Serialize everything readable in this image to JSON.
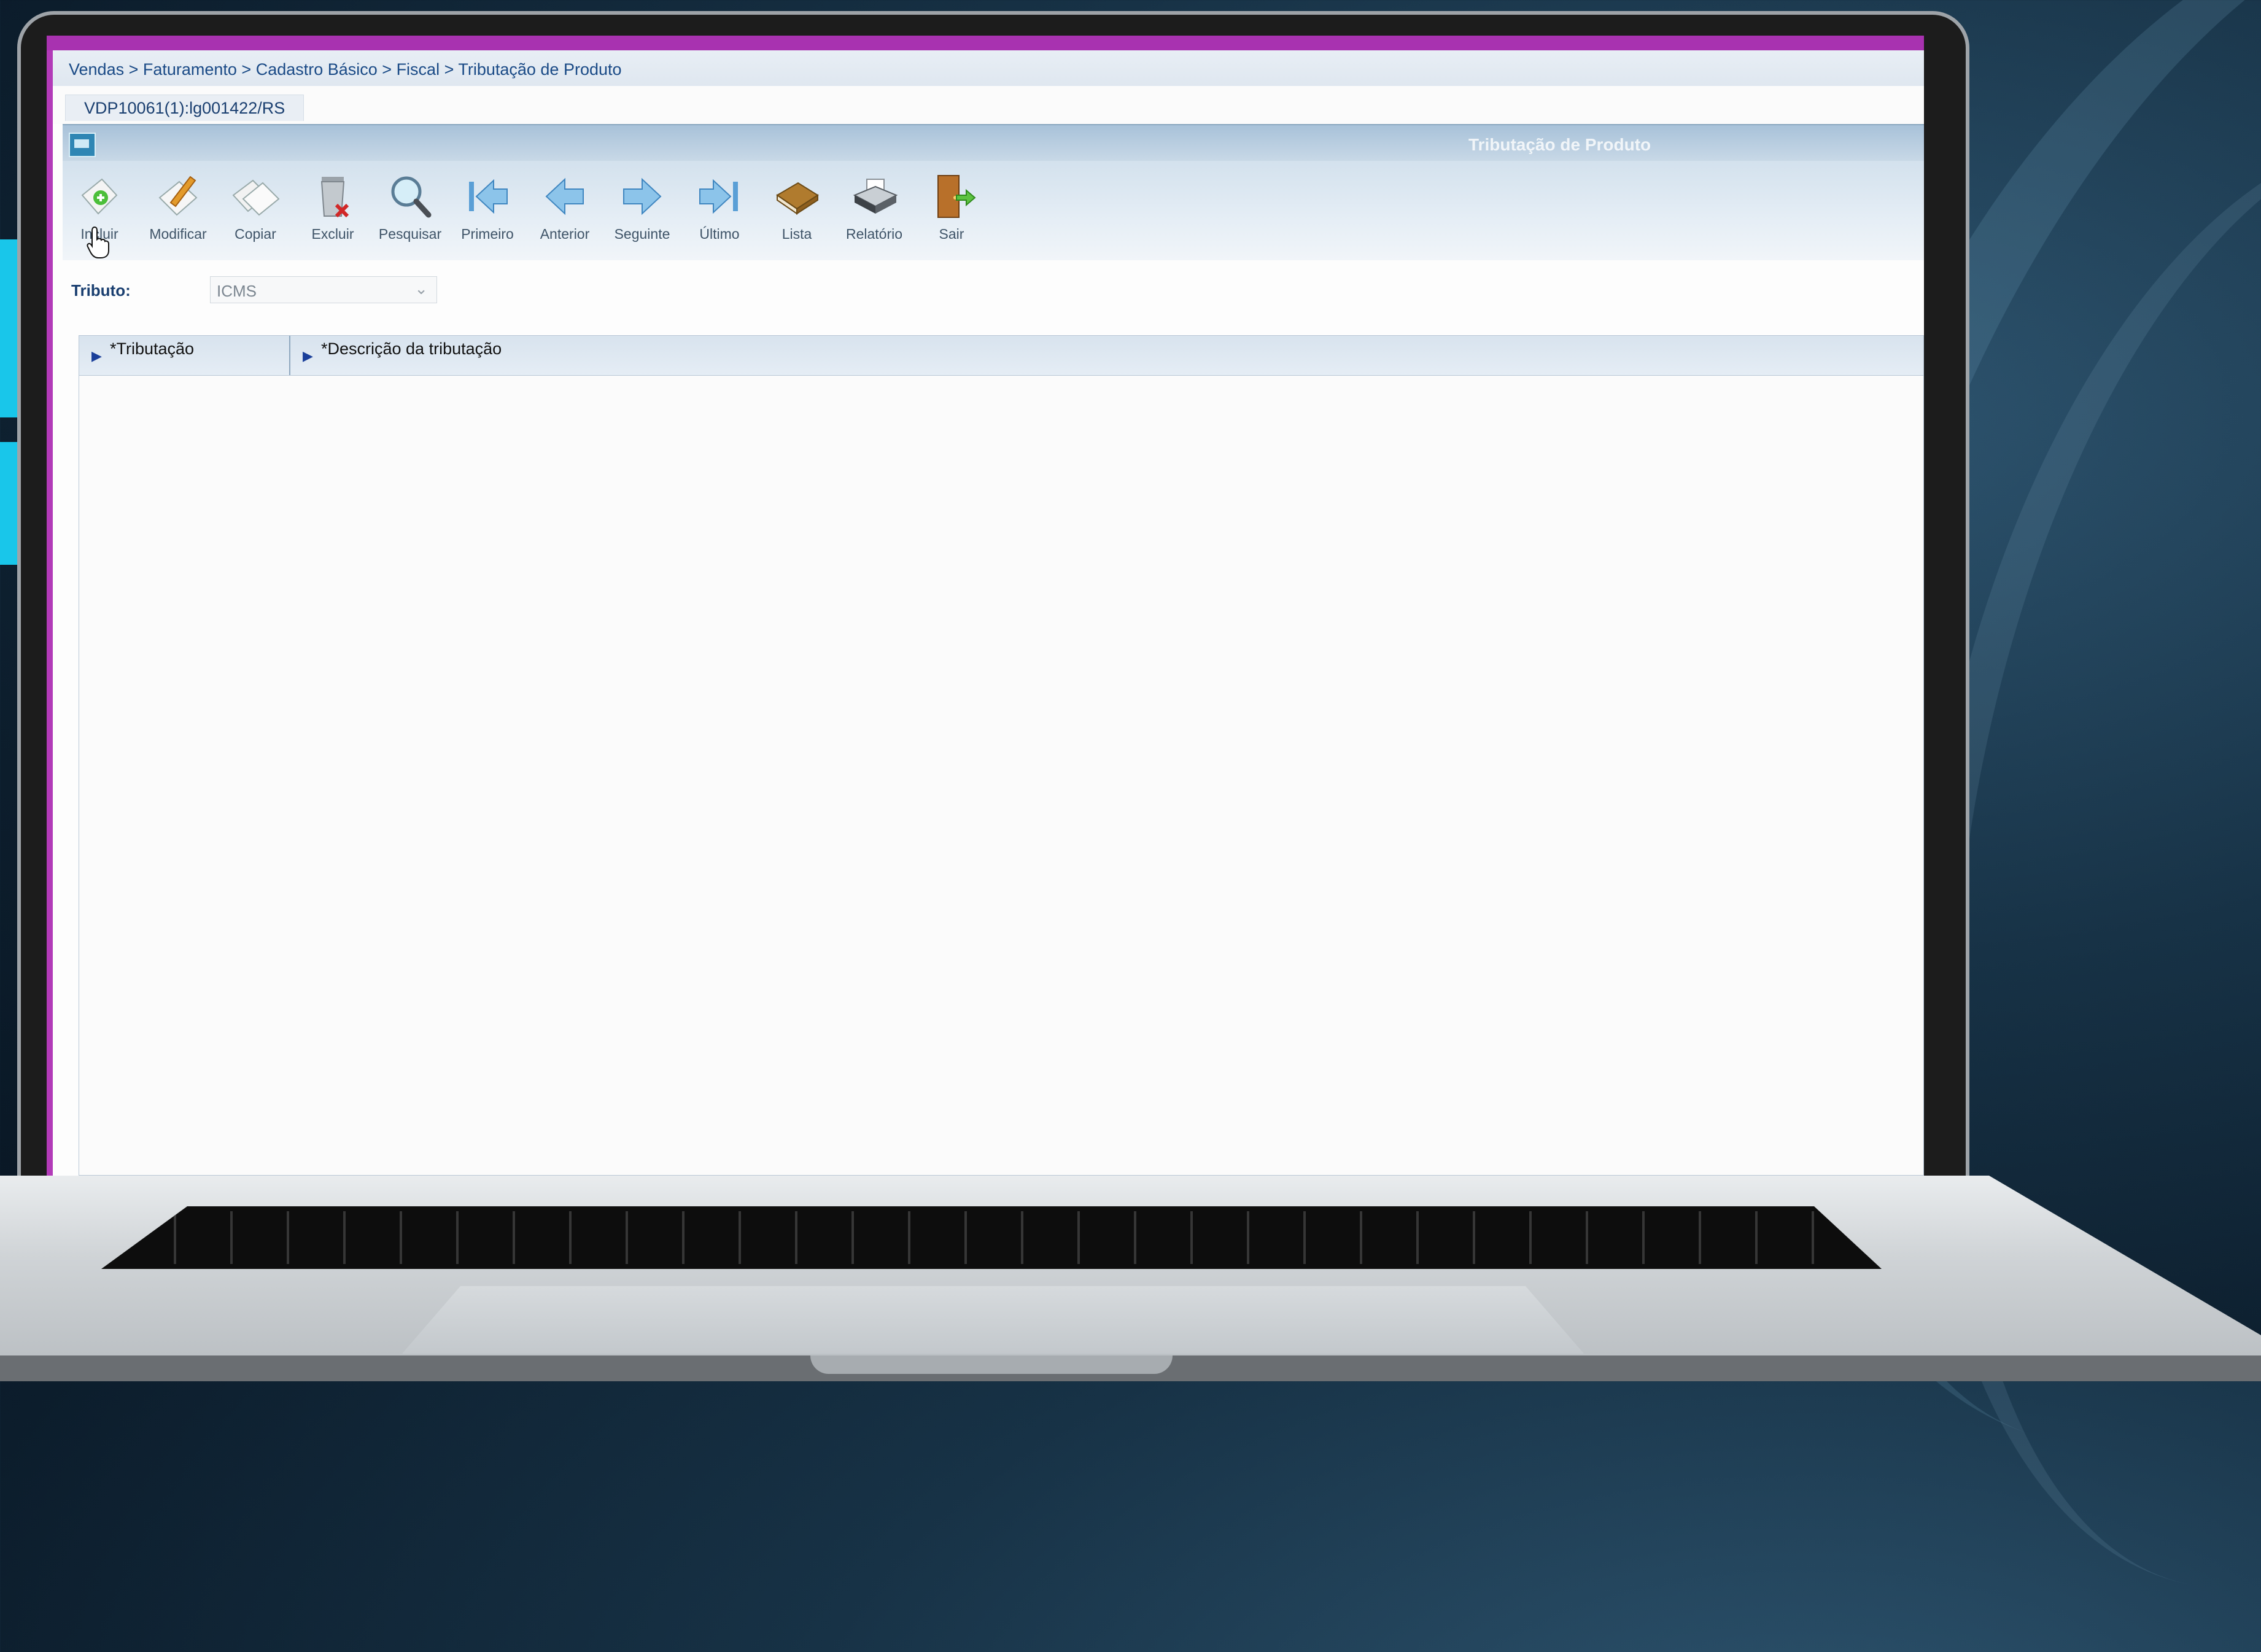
{
  "breadcrumb": "Vendas > Faturamento > Cadastro Básico > Fiscal > Tributação de Produto",
  "tab_label": "VDP10061(1):lg001422/RS",
  "window_title": "Tributação de Produto",
  "toolbar": {
    "incluir": "Incluir",
    "modificar": "Modificar",
    "copiar": "Copiar",
    "excluir": "Excluir",
    "pesquisar": "Pesquisar",
    "primeiro": "Primeiro",
    "anterior": "Anterior",
    "seguinte": "Seguinte",
    "ultimo": "Último",
    "lista": "Lista",
    "relatorio": "Relatório",
    "sair": "Sair"
  },
  "form": {
    "tributo_label": "Tributo:",
    "tributo_value": "ICMS"
  },
  "grid": {
    "columns": [
      "*Tributação",
      "*Descrição da tributação"
    ]
  },
  "colors": {
    "accent_purple": "#a832b0",
    "side_tab": "#19c6ea",
    "breadcrumb_text": "#1a4a86"
  }
}
